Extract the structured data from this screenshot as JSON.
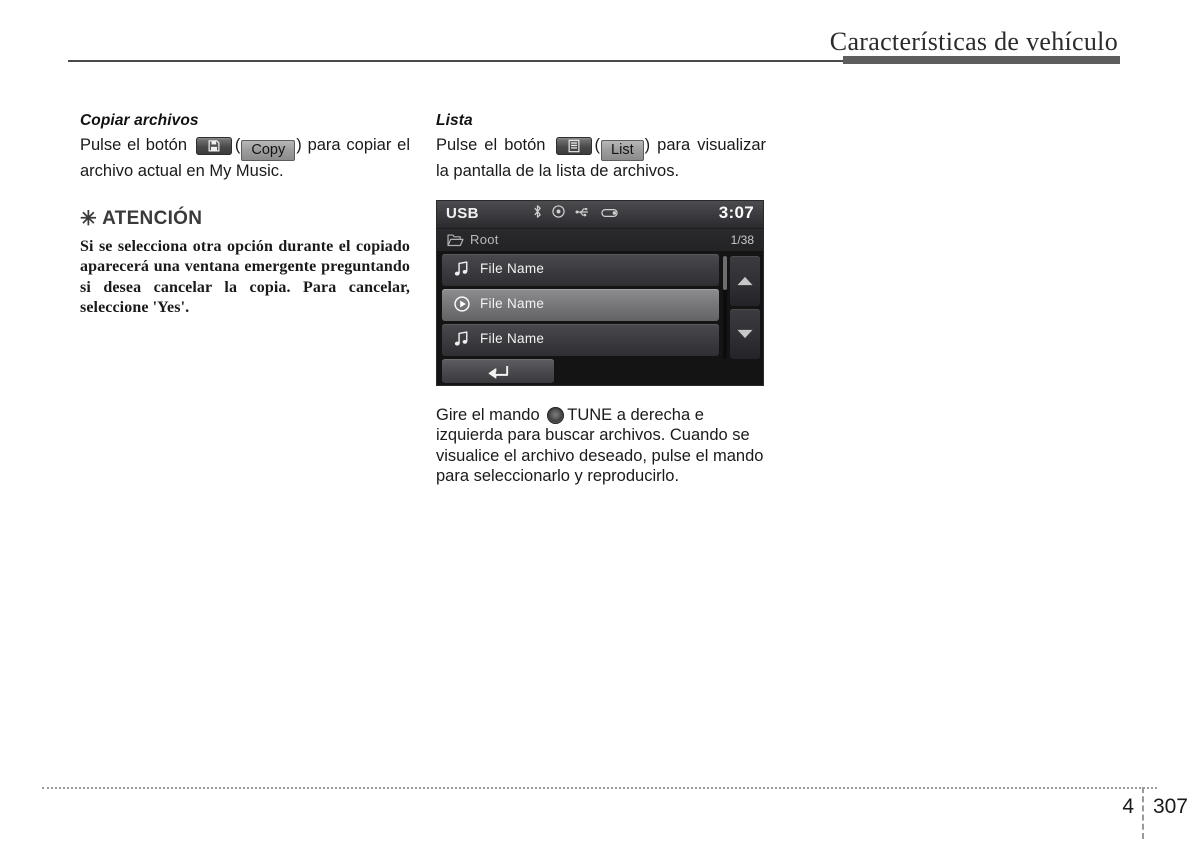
{
  "header": {
    "title": "Características de vehículo"
  },
  "left_column": {
    "heading": "Copiar archivos",
    "text_before_key": "Pulse el botón",
    "key_icon": "save-floppy-icon",
    "paren_open": "(",
    "chip_label": "Copy",
    "paren_close": ")",
    "text_after_chip": "para copiar el archivo actual en My Music."
  },
  "caution": {
    "asterisk": "✳",
    "heading": "ATENCIÓN",
    "text": "Si se selecciona otra opción durante el copiado aparecerá una ventana emergente preguntando si desea cancelar la copia. Para cancelar, seleccione 'Yes'."
  },
  "right_column": {
    "heading": "Lista",
    "text_before_key": "Pulse el botón",
    "key_icon": "list-lines-icon",
    "paren_open": "(",
    "chip_label": "List",
    "paren_close": ")",
    "text_after_chip": "para visualizar la pantalla de la lista de archivos."
  },
  "display": {
    "source": "USB",
    "clock": "3:07",
    "status_icons": [
      "bluetooth-icon",
      "disc-icon",
      "usb-icon",
      "usb-stick-icon"
    ],
    "path_folder_icon": "folder-open-icon",
    "path_label": "Root",
    "path_count": "1/38",
    "rows": [
      {
        "icon": "music-note-icon",
        "label": "File Name",
        "selected": false
      },
      {
        "icon": "play-circle-icon",
        "label": "File Name",
        "selected": true
      },
      {
        "icon": "music-note-icon",
        "label": "File Name",
        "selected": false
      }
    ],
    "scroll_up_icon": "triangle-up-icon",
    "scroll_down_icon": "triangle-down-icon",
    "back_icon": "back-arrow-icon"
  },
  "caption": {
    "text_before_knob": "Gire el mando",
    "knob_icon": "tune-knob-icon",
    "text_after_knob": "TUNE a derecha e izquierda para buscar archivos. Cuando se visualice el archivo deseado, pulse el mando para seleccionarlo y reproducirlo."
  },
  "footer": {
    "chapter": "4",
    "page": "307"
  }
}
